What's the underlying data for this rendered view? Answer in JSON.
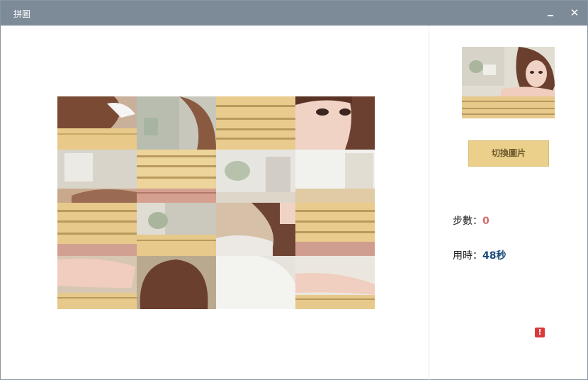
{
  "window": {
    "title": "拼圖",
    "minimize_icon": "minimize-icon",
    "close_icon": "close-icon",
    "close_glyph": "✕"
  },
  "puzzle": {
    "rows": 4,
    "cols": 4,
    "tiles": [
      "hair-shoulder",
      "hair-blur",
      "wood-planks",
      "face-eyes",
      "window-blur",
      "wood-planks-pink",
      "plant-blur",
      "window-bright",
      "wood-planks",
      "plant-window",
      "hair-shoulder-white",
      "wood-planks-pink",
      "arm-on-table",
      "hair-back",
      "white-blank",
      "arm-elbow"
    ]
  },
  "preview": {
    "label": "preview-thumbnail"
  },
  "controls": {
    "switch_label": "切換圖片"
  },
  "stats": {
    "steps_label": "步數：",
    "steps_value": "0",
    "time_label": "用時：",
    "time_value": "48秒"
  },
  "alert": {
    "icon": "alert-icon",
    "glyph": "!"
  },
  "colors": {
    "titlebar": "#7d8b99",
    "button": "#ead08a",
    "steps_value": "#d36a6a",
    "time_value": "#1b4b7a",
    "alert": "#d93a3a"
  }
}
